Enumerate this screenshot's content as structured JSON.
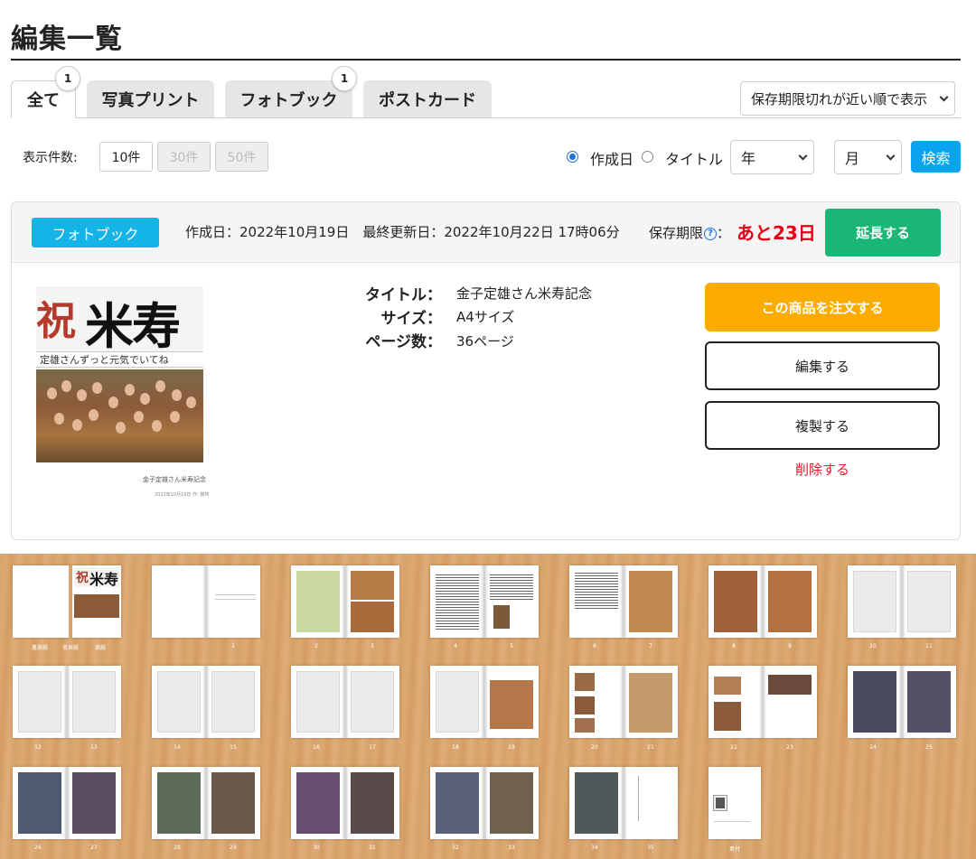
{
  "page": {
    "title": "編集一覧"
  },
  "tabs": [
    {
      "label": "全て",
      "badge": "1",
      "active": true
    },
    {
      "label": "写真プリント",
      "badge": "",
      "active": false
    },
    {
      "label": "フォトブック",
      "badge": "1",
      "active": false
    },
    {
      "label": "ポストカード",
      "badge": "",
      "active": false
    }
  ],
  "sort": {
    "selected": "保存期限切れが近い順で表示"
  },
  "filter": {
    "count_label": "表示件数:",
    "count_options": [
      "10件",
      "30件",
      "50件"
    ],
    "radio_created": "作成日",
    "radio_title": "タイトル",
    "year_select": "年",
    "month_select": "月",
    "search_label": "検索"
  },
  "item": {
    "type": "フォトブック",
    "dates": "作成日：2022年10月19日　最終更新日：2022年10月22日 17時06分",
    "expire_label": "保存期限",
    "expire_sep": "：",
    "expire_value": "あと23日",
    "extend_label": "延長する",
    "cover": {
      "kanji1": "祝",
      "kanji2": "米寿",
      "banner": "定雄さんずっと元気でいてね",
      "caption": "金子定雄さん米寿記念",
      "caption2": "2022年10月19日 作: 樹林"
    },
    "info": {
      "title_key": "タイトル：",
      "title_val": "金子定雄さん米寿記念",
      "size_key": "サイズ：",
      "size_val": "A4サイズ",
      "pages_key": "ページ数：",
      "pages_val": "36ページ"
    },
    "actions": {
      "order": "この商品を注文する",
      "edit": "編集する",
      "duplicate": "複製する",
      "delete": "削除する"
    }
  },
  "pages": {
    "row1": [
      {
        "l": "裏表紙",
        "m": "背表紙",
        "r": "表紙"
      },
      {
        "l": "",
        "r": "1"
      },
      {
        "l": "2",
        "r": "3"
      },
      {
        "l": "4",
        "r": "5"
      },
      {
        "l": "6",
        "r": "7"
      },
      {
        "l": "8",
        "r": "9"
      },
      {
        "l": "10",
        "r": "11"
      }
    ],
    "row2": [
      {
        "l": "12",
        "r": "13"
      },
      {
        "l": "14",
        "r": "15"
      },
      {
        "l": "16",
        "r": "17"
      },
      {
        "l": "18",
        "r": "19"
      },
      {
        "l": "20",
        "r": "21"
      },
      {
        "l": "22",
        "r": "23"
      },
      {
        "l": "24",
        "r": "25"
      }
    ],
    "row3": [
      {
        "l": "26",
        "r": "27"
      },
      {
        "l": "28",
        "r": "29"
      },
      {
        "l": "30",
        "r": "31"
      },
      {
        "l": "32",
        "r": "33"
      },
      {
        "l": "34",
        "r": "35"
      },
      {
        "l": "",
        "r": "奥付"
      }
    ]
  }
}
